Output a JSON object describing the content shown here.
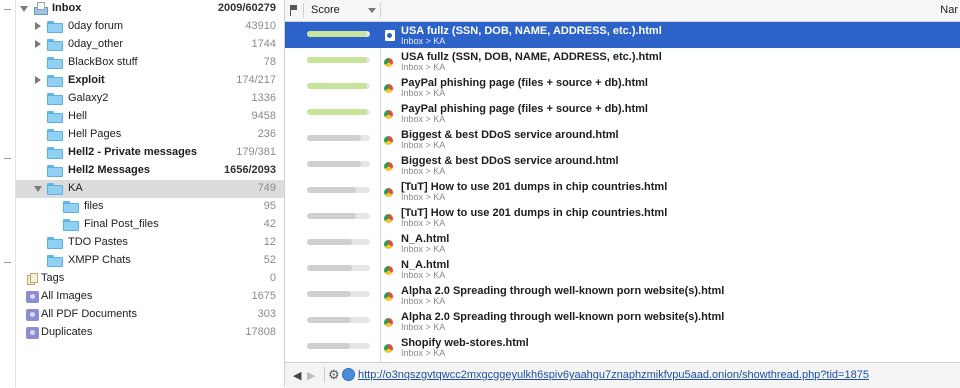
{
  "sidebar": {
    "inbox": {
      "label": "Inbox",
      "count": "2009/60279"
    },
    "items": [
      {
        "label": "0day forum",
        "count": "43910"
      },
      {
        "label": "0day_other",
        "count": "1744"
      },
      {
        "label": "BlackBox stuff",
        "count": "78"
      },
      {
        "label": "Exploit",
        "count": "174/217"
      },
      {
        "label": "Galaxy2",
        "count": "1336"
      },
      {
        "label": "Hell",
        "count": "9458"
      },
      {
        "label": "Hell Pages",
        "count": "236"
      },
      {
        "label": "Hell2 - Private messages",
        "count": "179/381"
      },
      {
        "label": "Hell2 Messages",
        "count": "1656/2093"
      },
      {
        "label": "KA",
        "count": "749"
      },
      {
        "label": "files",
        "count": "95"
      },
      {
        "label": "Final Post_files",
        "count": "42"
      },
      {
        "label": "TDO Pastes",
        "count": "12"
      },
      {
        "label": "XMPP Chats",
        "count": "52"
      }
    ],
    "tags": {
      "label": "Tags",
      "count": "0"
    },
    "smart": [
      {
        "label": "All Images",
        "count": "1675"
      },
      {
        "label": "All PDF Documents",
        "count": "303"
      },
      {
        "label": "Duplicates",
        "count": "17808"
      }
    ]
  },
  "list": {
    "header": {
      "score_label": "Score",
      "name_label": "Nar"
    },
    "rows": [
      {
        "title": "USA fullz (SSN, DOB, NAME, ADDRESS, etc.).html",
        "path": "Inbox > KA",
        "score": 0.95
      },
      {
        "title": "USA fullz (SSN, DOB, NAME, ADDRESS, etc.).html",
        "path": "Inbox > KA",
        "score": 0.95
      },
      {
        "title": "PayPal phishing page (files + source + db).html",
        "path": "Inbox > KA",
        "score": 0.95
      },
      {
        "title": "PayPal phishing page (files + source + db).html",
        "path": "Inbox > KA",
        "score": 0.95
      },
      {
        "title": "Biggest & best DDoS service around.html",
        "path": "Inbox > KA",
        "score": 0.85
      },
      {
        "title": "Biggest & best DDoS service around.html",
        "path": "Inbox > KA",
        "score": 0.85
      },
      {
        "title": "[TuT] How to use 201 dumps in chip countries.html",
        "path": "Inbox > KA",
        "score": 0.78
      },
      {
        "title": "[TuT] How to use 201 dumps in chip countries.html",
        "path": "Inbox > KA",
        "score": 0.78
      },
      {
        "title": "N_A.html",
        "path": "Inbox > KA",
        "score": 0.72
      },
      {
        "title": "N_A.html",
        "path": "Inbox > KA",
        "score": 0.72
      },
      {
        "title": "Alpha 2.0 Spreading through well-known porn website(s).html",
        "path": "Inbox > KA",
        "score": 0.7
      },
      {
        "title": "Alpha 2.0 Spreading through well-known porn website(s).html",
        "path": "Inbox > KA",
        "score": 0.7
      },
      {
        "title": "Shopify web-stores.html",
        "path": "Inbox > KA",
        "score": 0.68
      }
    ]
  },
  "footer": {
    "url": "http://o3nqszgvtqwcc2mxgcggeyulkh6spiv6yaahgu7znaphzmikfvpu5aad.onion/showthread.php?tid=1875"
  },
  "colors": {
    "selection": "#2d63c8",
    "score_high": "#c8e39a",
    "score_mid": "#cfcfcf",
    "folder": "#8fd0f3"
  }
}
